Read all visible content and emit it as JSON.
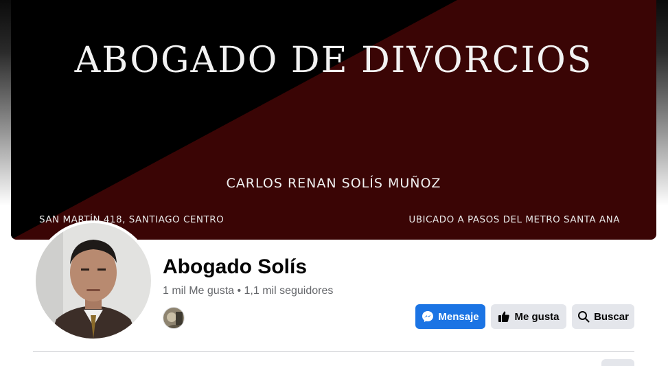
{
  "cover": {
    "title": "ABOGADO DE DIVORCIOS",
    "name": "CARLOS RENAN SOLÍS MUÑOZ",
    "address": "SAN MARTÍN 418, SANTIAGO CENTRO",
    "location": "UBICADO A PASOS DEL METRO SANTA ANA",
    "colors": {
      "dark": "#000000",
      "accent": "#3a0505"
    }
  },
  "profile": {
    "name": "Abogado Solís",
    "stats": "1 mil Me gusta • 1,1 mil seguidores"
  },
  "actions": {
    "message_label": "Mensaje",
    "like_label": "Me gusta",
    "search_label": "Buscar"
  },
  "icons": {
    "message": "messenger-icon",
    "like": "thumbs-up-icon",
    "search": "search-icon"
  },
  "colors": {
    "primary": "#1b74e4",
    "secondary_button": "#e4e6eb",
    "text": "#050505",
    "muted": "#65676b"
  }
}
